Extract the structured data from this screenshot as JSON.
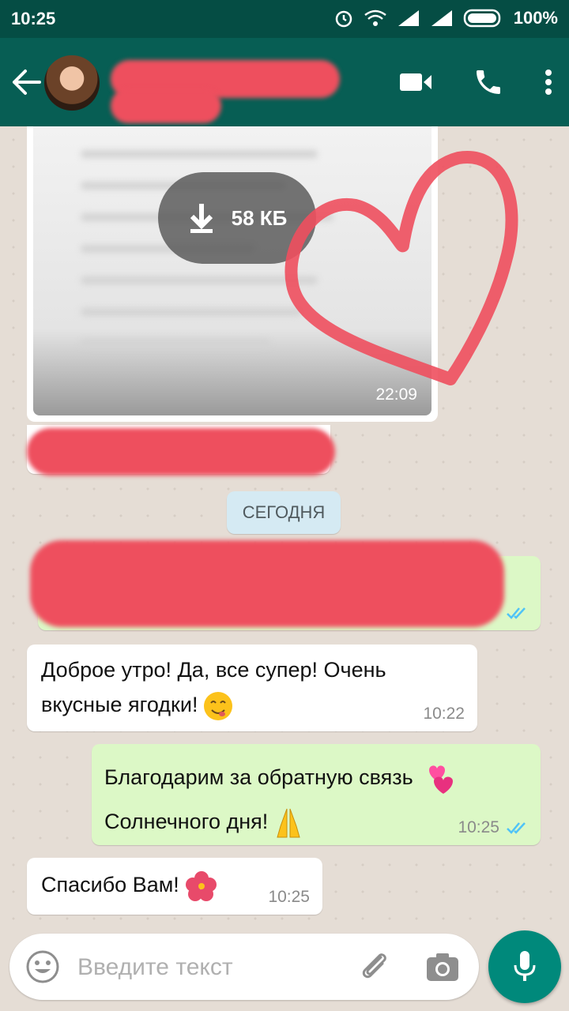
{
  "status_bar": {
    "time": "10:25",
    "battery": "100%"
  },
  "media_message": {
    "download_size": "58 КБ",
    "time": "22:09"
  },
  "date_divider": "СЕГОДНЯ",
  "messages": [
    {
      "text_line1": "Доброе утро! Да, все супер! Очень",
      "text_line2": "вкусные ягодки!",
      "time": "10:22"
    },
    {
      "text_line1": "Благодарим за обратную связь",
      "text_line2": "Солнечного дня!",
      "time": "10:25"
    },
    {
      "text_line1": "Спасибо Вам!",
      "time": "10:25"
    }
  ],
  "input": {
    "placeholder": "Введите текст"
  },
  "icons": [
    "back-arrow-icon",
    "video-call-icon",
    "phone-icon",
    "more-vert-icon",
    "download-icon",
    "double-check-icon",
    "emoji-icon",
    "attach-icon",
    "camera-icon",
    "mic-icon",
    "alarm-icon",
    "wifi-icon",
    "signal-icon",
    "battery-icon"
  ],
  "colors": {
    "header": "#075e54",
    "status_bar": "#054d44",
    "outgoing": "#dcf8c6",
    "incoming": "#ffffff",
    "read_ticks": "#4fc3f7",
    "fab": "#00897b",
    "redaction": "#ee4f5e"
  }
}
